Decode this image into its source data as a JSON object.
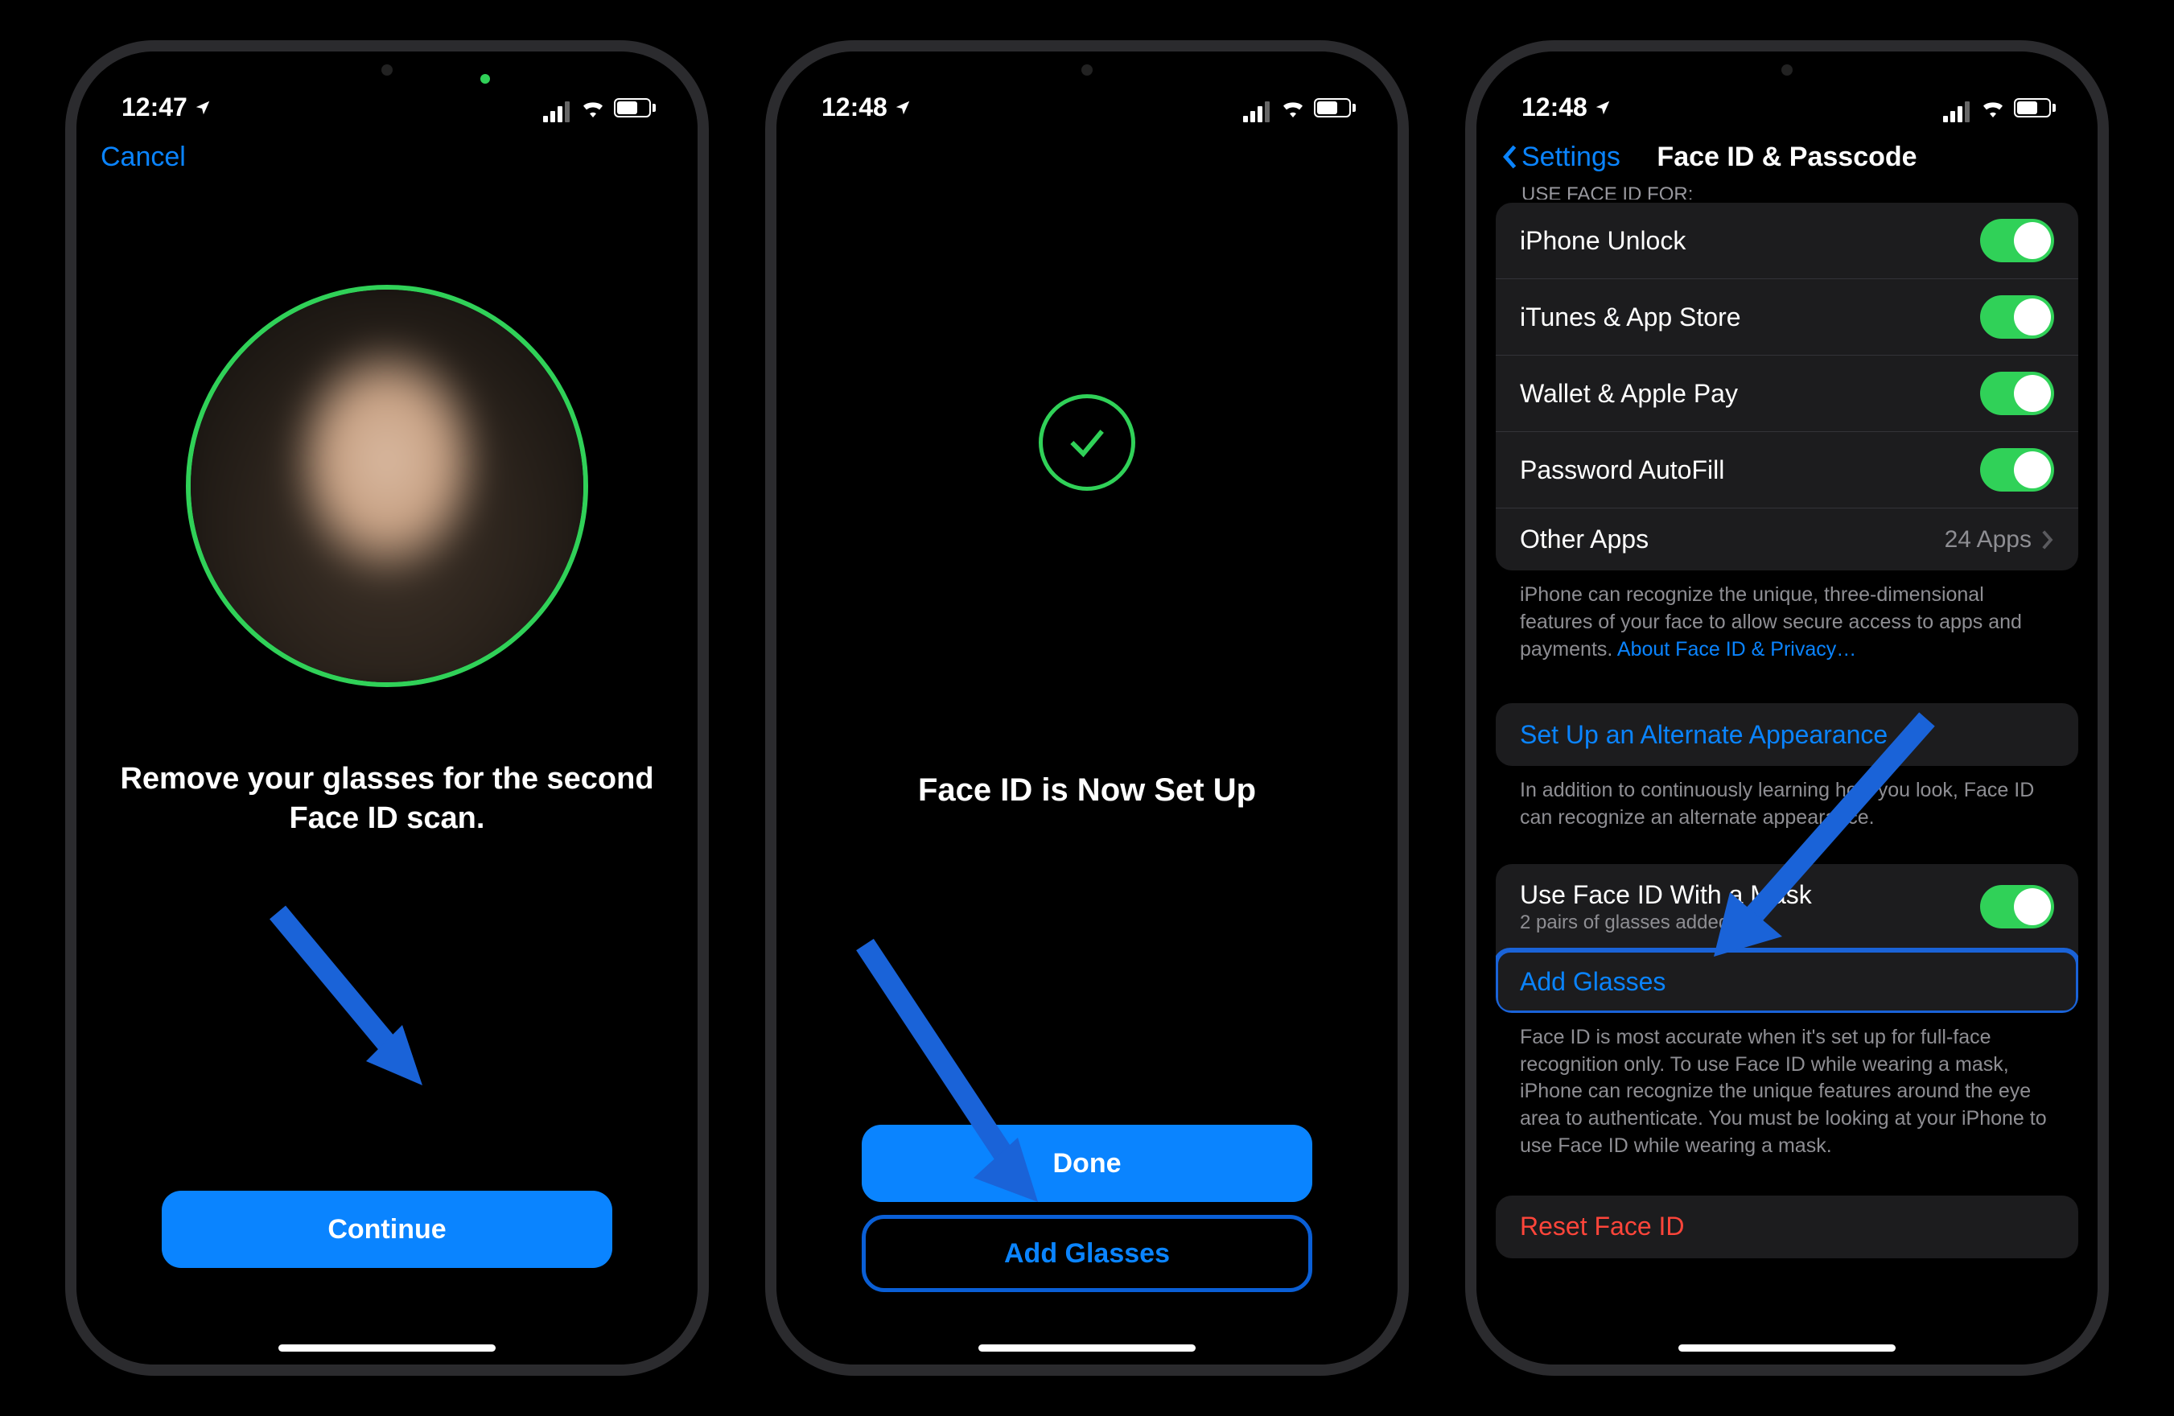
{
  "phone1": {
    "time": "12:47",
    "cancel": "Cancel",
    "instruction": "Remove your glasses for the second Face ID scan.",
    "continue": "Continue"
  },
  "phone2": {
    "time": "12:48",
    "title": "Face ID is Now Set Up",
    "done": "Done",
    "add_glasses": "Add Glasses"
  },
  "phone3": {
    "time": "12:48",
    "back": "Settings",
    "title": "Face ID & Passcode",
    "use_for_header": "USE FACE ID FOR:",
    "rows": {
      "iphone_unlock": "iPhone Unlock",
      "itunes": "iTunes & App Store",
      "wallet": "Wallet & Apple Pay",
      "autofill": "Password AutoFill",
      "other_apps": "Other Apps",
      "other_apps_count": "24 Apps"
    },
    "footer1a": "iPhone can recognize the unique, three-dimensional features of your face to allow secure access to apps and payments. ",
    "footer1link": "About Face ID & Privacy…",
    "alt_appearance": "Set Up an Alternate Appearance",
    "footer2": "In addition to continuously learning how you look, Face ID can recognize an alternate appearance.",
    "mask_label": "Use Face ID With a Mask",
    "mask_sub": "2 pairs of glasses added",
    "add_glasses": "Add Glasses",
    "footer3": "Face ID is most accurate when it's set up for full-face recognition only. To use Face ID while wearing a mask, iPhone can recognize the unique features around the eye area to authenticate. You must be looking at your iPhone to use Face ID while wearing a mask.",
    "reset": "Reset Face ID"
  }
}
